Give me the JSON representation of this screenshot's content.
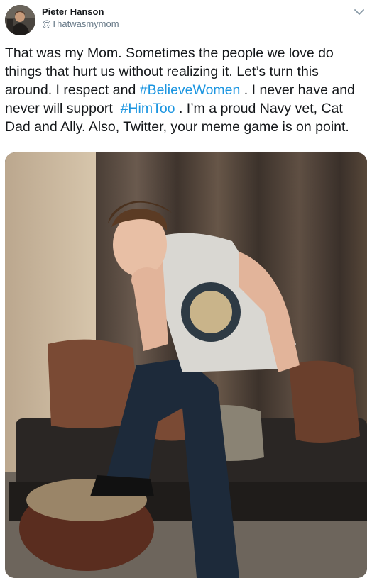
{
  "user": {
    "display_name": "Pieter Hanson",
    "handle": "@Thatwasmymom"
  },
  "tweet": {
    "text_1": "That was my Mom. Sometimes the people we love do things that hurt us without realizing it. Let’s turn this around. I respect and ",
    "hashtag_1": "#BelieveWomen",
    "text_2": " . I never have and never will support  ",
    "hashtag_2": "#HimToo",
    "text_3": " . I’m a proud Navy vet, Cat Dad and Ally. Also, Twitter, your meme game is on point."
  },
  "colors": {
    "hashtag": "#1b95e0",
    "handle": "#657786",
    "text": "#14171a"
  },
  "icons": {
    "menu": "chevron-down-icon"
  }
}
